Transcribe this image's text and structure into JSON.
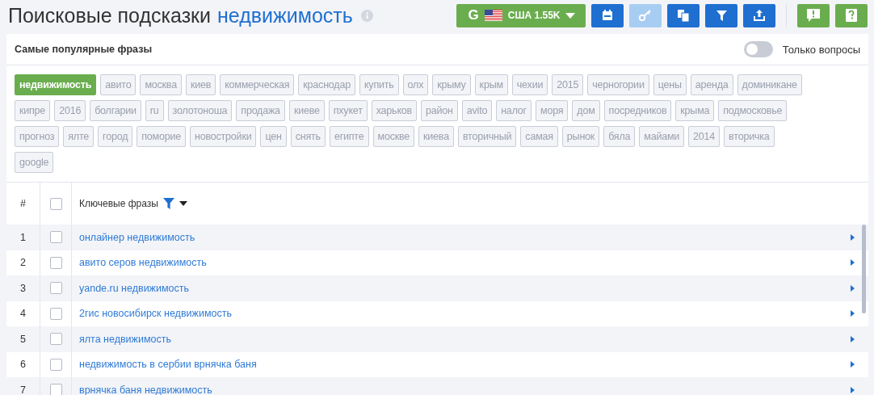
{
  "header": {
    "title": "Поисковые подсказки",
    "keyword": "недвижимость"
  },
  "country_button": {
    "engine": "G",
    "label": "США 1.55K"
  },
  "toolbar": [
    {
      "kind": "calendar",
      "disabled": false
    },
    {
      "kind": "key",
      "disabled": true
    },
    {
      "kind": "copy",
      "disabled": false
    },
    {
      "kind": "filter",
      "disabled": false
    },
    {
      "kind": "export",
      "disabled": false
    }
  ],
  "side_buttons": [
    {
      "kind": "feedback"
    },
    {
      "kind": "help"
    }
  ],
  "panel": {
    "title": "Самые популярные фразы",
    "questions_toggle": {
      "label": "Только вопросы",
      "on": false
    }
  },
  "tags": [
    {
      "label": "недвижимость",
      "selected": true
    },
    {
      "label": "авито",
      "selected": false
    },
    {
      "label": "москва",
      "selected": false
    },
    {
      "label": "киев",
      "selected": false
    },
    {
      "label": "коммерческая",
      "selected": false
    },
    {
      "label": "краснодар",
      "selected": false
    },
    {
      "label": "купить",
      "selected": false
    },
    {
      "label": "олх",
      "selected": false
    },
    {
      "label": "крыму",
      "selected": false
    },
    {
      "label": "крым",
      "selected": false
    },
    {
      "label": "чехии",
      "selected": false
    },
    {
      "label": "2015",
      "selected": false
    },
    {
      "label": "черногории",
      "selected": false
    },
    {
      "label": "цены",
      "selected": false
    },
    {
      "label": "аренда",
      "selected": false
    },
    {
      "label": "доминикане",
      "selected": false
    },
    {
      "label": "кипре",
      "selected": false
    },
    {
      "label": "2016",
      "selected": false
    },
    {
      "label": "болгарии",
      "selected": false
    },
    {
      "label": "ru",
      "selected": false
    },
    {
      "label": "золотоноша",
      "selected": false
    },
    {
      "label": "продажа",
      "selected": false
    },
    {
      "label": "киеве",
      "selected": false
    },
    {
      "label": "пхукет",
      "selected": false
    },
    {
      "label": "харьков",
      "selected": false
    },
    {
      "label": "район",
      "selected": false
    },
    {
      "label": "avito",
      "selected": false
    },
    {
      "label": "налог",
      "selected": false
    },
    {
      "label": "моря",
      "selected": false
    },
    {
      "label": "дом",
      "selected": false
    },
    {
      "label": "посредников",
      "selected": false
    },
    {
      "label": "крыма",
      "selected": false
    },
    {
      "label": "подмосковье",
      "selected": false
    },
    {
      "label": "прогноз",
      "selected": false
    },
    {
      "label": "ялте",
      "selected": false
    },
    {
      "label": "город",
      "selected": false
    },
    {
      "label": "поморие",
      "selected": false
    },
    {
      "label": "новостройки",
      "selected": false
    },
    {
      "label": "цен",
      "selected": false
    },
    {
      "label": "снять",
      "selected": false
    },
    {
      "label": "египте",
      "selected": false
    },
    {
      "label": "москве",
      "selected": false
    },
    {
      "label": "киева",
      "selected": false
    },
    {
      "label": "вторичный",
      "selected": false
    },
    {
      "label": "самая",
      "selected": false
    },
    {
      "label": "рынок",
      "selected": false
    },
    {
      "label": "бяла",
      "selected": false
    },
    {
      "label": "майами",
      "selected": false
    },
    {
      "label": "2014",
      "selected": false
    },
    {
      "label": "вторичка",
      "selected": false
    },
    {
      "label": "google",
      "selected": false
    }
  ],
  "table": {
    "columns": [
      "#",
      "Ключевые фразы"
    ],
    "header_checked": false,
    "rows": [
      {
        "number": "1",
        "phrase": "онлайнер недвижимость",
        "checked": false
      },
      {
        "number": "2",
        "phrase": "авито серов недвижимость",
        "checked": false
      },
      {
        "number": "3",
        "phrase": "yande.ru недвижимость",
        "checked": false
      },
      {
        "number": "4",
        "phrase": "2гис новосибирск недвижимость",
        "checked": false
      },
      {
        "number": "5",
        "phrase": "ялта недвижимость",
        "checked": false
      },
      {
        "number": "6",
        "phrase": "недвижимость в сербии врнячка баня",
        "checked": false
      },
      {
        "number": "7",
        "phrase": "врнячка баня недвижимость",
        "checked": false
      }
    ]
  }
}
